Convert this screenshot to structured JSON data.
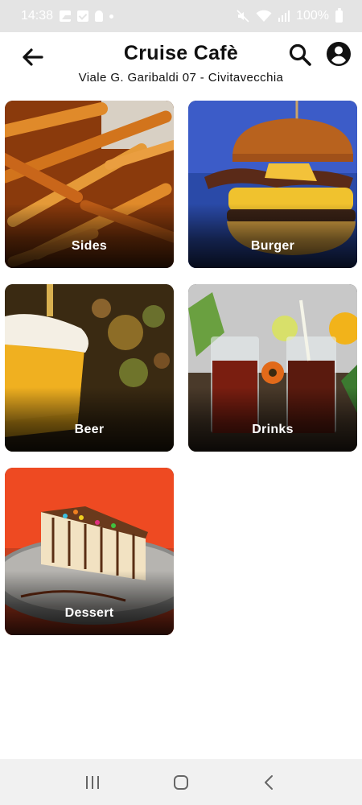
{
  "status_bar": {
    "time": "14:38",
    "battery": "100%",
    "icons": [
      "gallery-icon",
      "checkbox-icon",
      "bulb-icon",
      "dot-icon",
      "mute-icon",
      "wifi-icon",
      "signal-icon",
      "battery-icon"
    ]
  },
  "header": {
    "title": "Cruise Cafè",
    "address": "Viale G. Garibaldi 07 - Civitavecchia",
    "back_icon": "arrow-left-icon",
    "search_icon": "search-icon",
    "account_icon": "account-circle-icon"
  },
  "categories": [
    {
      "label": "Sides"
    },
    {
      "label": "Burger"
    },
    {
      "label": "Beer"
    },
    {
      "label": "Drinks"
    },
    {
      "label": "Dessert"
    }
  ],
  "nav_bar": {
    "recent_icon": "recent-apps-icon",
    "home_icon": "home-icon",
    "back_icon": "back-chevron-icon"
  },
  "colors": {
    "status_bar_bg": "#e4e4e4",
    "page_bg": "#ffffff",
    "nav_bar_bg": "#f1f1f1",
    "card_label": "#ffffff"
  }
}
